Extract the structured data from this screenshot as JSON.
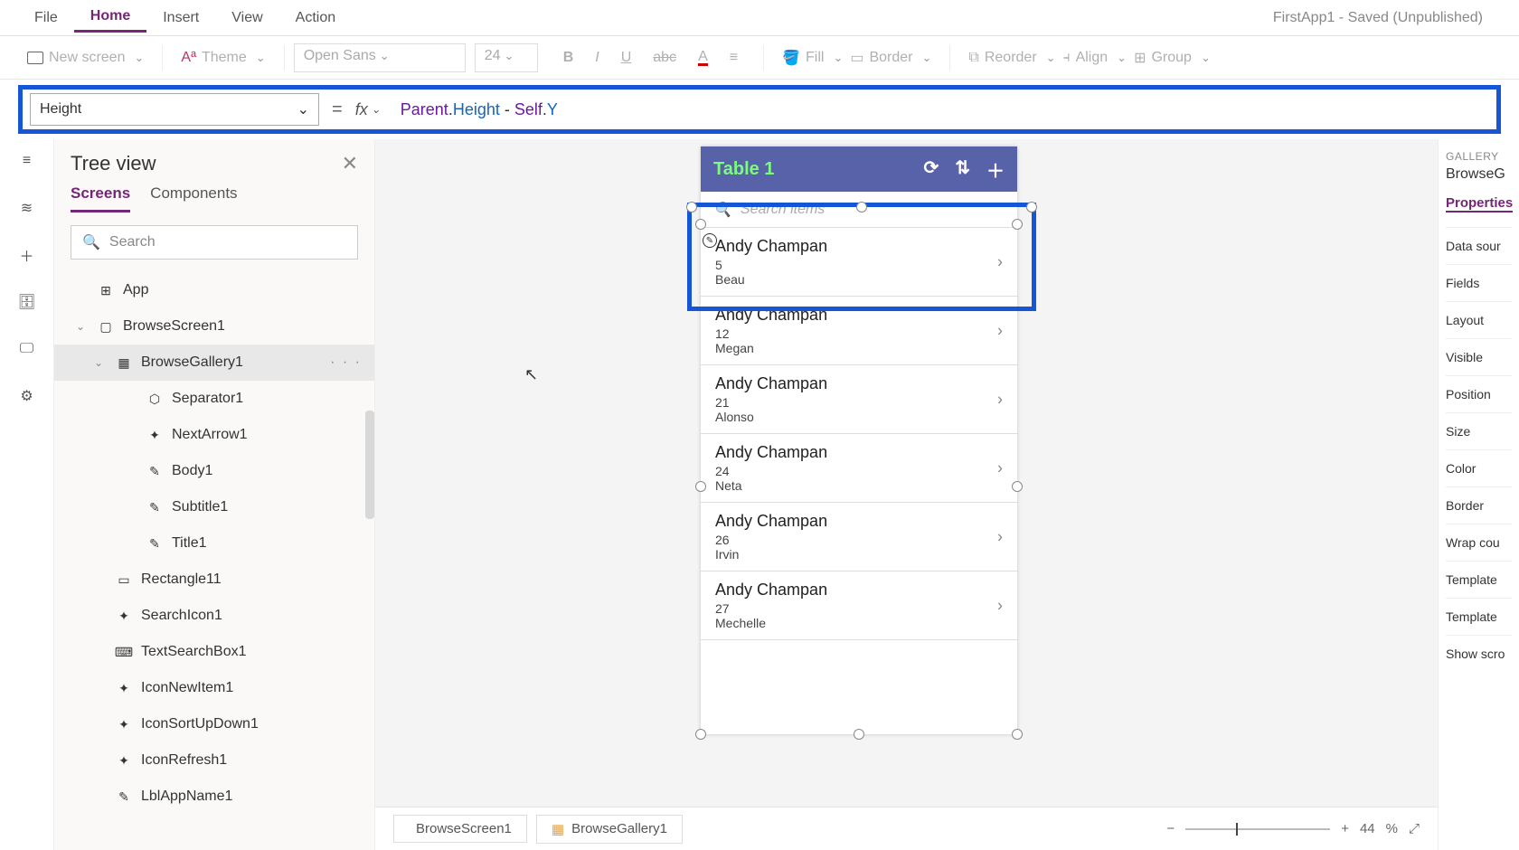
{
  "menubar": {
    "file": "File",
    "home": "Home",
    "insert": "Insert",
    "view": "View",
    "action": "Action",
    "appTitle": "FirstApp1 - Saved (Unpublished)"
  },
  "ribbon": {
    "newScreen": "New screen",
    "theme": "Theme",
    "font": "Open Sans",
    "fontSize": "24",
    "fill": "Fill",
    "border": "Border",
    "reorder": "Reorder",
    "align": "Align",
    "group": "Group"
  },
  "formula": {
    "property": "Height",
    "fx": "fx",
    "expr_parent": "Parent",
    "expr_dot1": ".",
    "expr_height": "Height",
    "expr_minus": " - ",
    "expr_self": "Self",
    "expr_dot2": ".",
    "expr_y": "Y"
  },
  "treeview": {
    "title": "Tree view",
    "tab_screens": "Screens",
    "tab_components": "Components",
    "search_placeholder": "Search",
    "items": [
      {
        "label": "App",
        "indent": 1,
        "icon": "app"
      },
      {
        "label": "BrowseScreen1",
        "indent": 1,
        "icon": "screen",
        "expanded": true
      },
      {
        "label": "BrowseGallery1",
        "indent": 2,
        "icon": "gallery",
        "expanded": true,
        "selected": true,
        "dots": "· · ·"
      },
      {
        "label": "Separator1",
        "indent": 3,
        "icon": "sep"
      },
      {
        "label": "NextArrow1",
        "indent": 3,
        "icon": "icon"
      },
      {
        "label": "Body1",
        "indent": 3,
        "icon": "label"
      },
      {
        "label": "Subtitle1",
        "indent": 3,
        "icon": "label"
      },
      {
        "label": "Title1",
        "indent": 3,
        "icon": "label"
      },
      {
        "label": "Rectangle11",
        "indent": 2,
        "icon": "rect"
      },
      {
        "label": "SearchIcon1",
        "indent": 2,
        "icon": "icon"
      },
      {
        "label": "TextSearchBox1",
        "indent": 2,
        "icon": "input"
      },
      {
        "label": "IconNewItem1",
        "indent": 2,
        "icon": "icon"
      },
      {
        "label": "IconSortUpDown1",
        "indent": 2,
        "icon": "icon"
      },
      {
        "label": "IconRefresh1",
        "indent": 2,
        "icon": "icon"
      },
      {
        "label": "LblAppName1",
        "indent": 2,
        "icon": "label"
      }
    ]
  },
  "phone": {
    "title": "Table 1",
    "searchPlaceholder": "Search items",
    "items": [
      {
        "title": "Andy Champan",
        "sub": "5",
        "body": "Beau"
      },
      {
        "title": "Andy Champan",
        "sub": "12",
        "body": "Megan"
      },
      {
        "title": "Andy Champan",
        "sub": "21",
        "body": "Alonso"
      },
      {
        "title": "Andy Champan",
        "sub": "24",
        "body": "Neta"
      },
      {
        "title": "Andy Champan",
        "sub": "26",
        "body": "Irvin"
      },
      {
        "title": "Andy Champan",
        "sub": "27",
        "body": "Mechelle"
      }
    ]
  },
  "bottombar": {
    "crumb1": "BrowseScreen1",
    "crumb2": "BrowseGallery1",
    "zoom": "44",
    "zoomUnit": "%"
  },
  "props": {
    "catLabel": "GALLERY",
    "name": "BrowseG",
    "tab": "Properties",
    "rows": [
      "Data sour",
      "Fields",
      "Layout",
      "Visible",
      "Position",
      "Size",
      "Color",
      "Border",
      "Wrap cou",
      "Template",
      "Template",
      "Show scro"
    ]
  }
}
